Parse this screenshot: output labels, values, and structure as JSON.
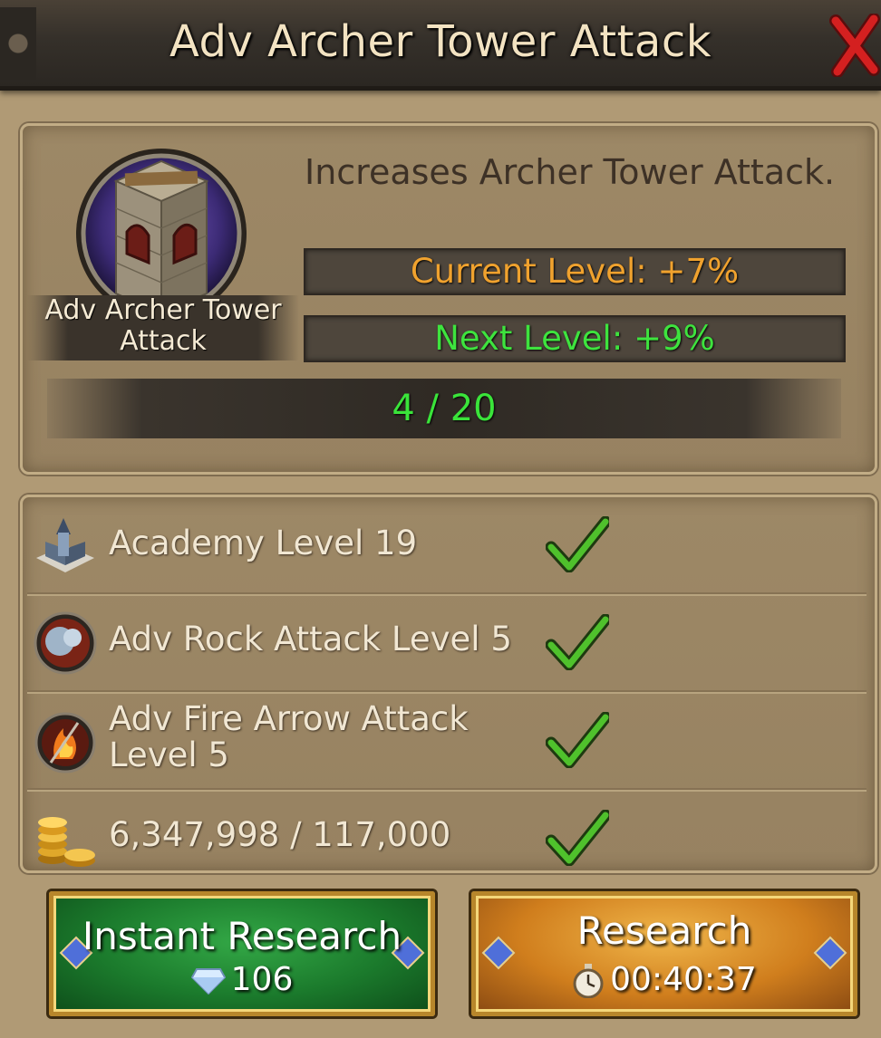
{
  "header": {
    "title": "Adv Archer Tower Attack",
    "close_icon": "close-x-icon"
  },
  "tech": {
    "icon": "archer-tower-icon",
    "name": "Adv Archer Tower Attack",
    "description": "Increases Archer Tower Attack.",
    "current_level": "Current Level: +7%",
    "next_level": "Next Level: +9%",
    "progress": "4 / 20",
    "progress_value": 4,
    "progress_max": 20
  },
  "requirements": [
    {
      "icon": "academy-building-icon",
      "text": "Academy Level 19",
      "met": true
    },
    {
      "icon": "rock-attack-icon",
      "text": "Adv Rock Attack Level 5",
      "met": true
    },
    {
      "icon": "fire-arrow-icon",
      "text": "Adv Fire Arrow Attack Level 5",
      "met": true
    },
    {
      "icon": "gold-coins-icon",
      "text": "6,347,998 / 117,000",
      "met": true
    }
  ],
  "buttons": {
    "instant": {
      "label": "Instant Research",
      "cost": "106",
      "cost_icon": "diamond-gem-icon"
    },
    "research": {
      "label": "Research",
      "time": "00:40:37",
      "time_icon": "stopwatch-icon"
    }
  },
  "colors": {
    "current_level": "#f0a22e",
    "next_level": "#3ee33e",
    "check": "#4fc12c",
    "instant_button": "#1b7a2c",
    "research_button": "#d07e1d"
  }
}
